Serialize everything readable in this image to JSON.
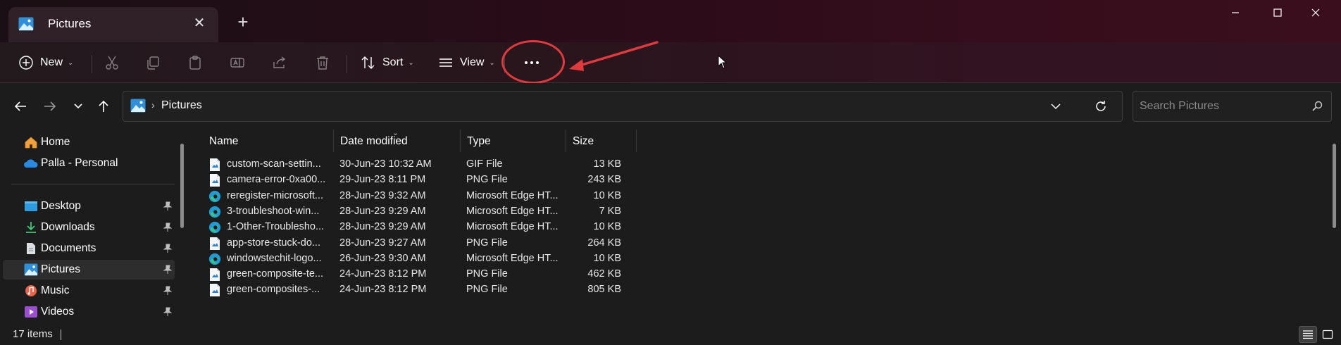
{
  "window": {
    "tab_title": "Pictures",
    "tab_close_glyph": "✕",
    "new_tab_glyph": "+",
    "minimize_glyph": "—",
    "maximize_glyph": "☐",
    "close_glyph": "✕"
  },
  "toolbar": {
    "new_label": "New",
    "sort_label": "Sort",
    "view_label": "View",
    "more_glyph": "···",
    "icons": [
      "add-icon",
      "cut-icon",
      "copy-icon",
      "paste-icon",
      "rename-icon",
      "share-icon",
      "delete-icon",
      "sort-icon",
      "view-icon",
      "more-options-icon"
    ]
  },
  "annotation": {
    "color": "#e03a3e"
  },
  "address_bar": {
    "separator": "›",
    "path": "Pictures",
    "search_placeholder": "Search Pictures"
  },
  "sidebar": {
    "items": [
      {
        "label": "Home",
        "icon": "home-icon",
        "pinned": false
      },
      {
        "label": "Palla - Personal",
        "icon": "onedrive-icon",
        "pinned": false
      },
      {
        "label": "Desktop",
        "icon": "desktop-icon",
        "pinned": true
      },
      {
        "label": "Downloads",
        "icon": "downloads-icon",
        "pinned": true
      },
      {
        "label": "Documents",
        "icon": "documents-icon",
        "pinned": true
      },
      {
        "label": "Pictures",
        "icon": "pictures-icon",
        "pinned": true,
        "selected": true
      },
      {
        "label": "Music",
        "icon": "music-icon",
        "pinned": true
      },
      {
        "label": "Videos",
        "icon": "videos-icon",
        "pinned": true
      }
    ]
  },
  "file_list": {
    "columns": [
      "Name",
      "Date modified",
      "Type",
      "Size"
    ],
    "sorted_by": "Date modified",
    "rows": [
      {
        "name": "custom-scan-settin...",
        "date": "30-Jun-23 10:32 AM",
        "type": "GIF File",
        "size": "13 KB",
        "icon": "image-file-icon"
      },
      {
        "name": "camera-error-0xa00...",
        "date": "29-Jun-23 8:11 PM",
        "type": "PNG File",
        "size": "243 KB",
        "icon": "image-file-icon"
      },
      {
        "name": "reregister-microsoft...",
        "date": "28-Jun-23 9:32 AM",
        "type": "Microsoft Edge HT...",
        "size": "10 KB",
        "icon": "edge-icon"
      },
      {
        "name": "3-troubleshoot-win...",
        "date": "28-Jun-23 9:29 AM",
        "type": "Microsoft Edge HT...",
        "size": "7 KB",
        "icon": "edge-icon"
      },
      {
        "name": "1-Other-Troublesho...",
        "date": "28-Jun-23 9:29 AM",
        "type": "Microsoft Edge HT...",
        "size": "10 KB",
        "icon": "edge-icon"
      },
      {
        "name": "app-store-stuck-do...",
        "date": "28-Jun-23 9:27 AM",
        "type": "PNG File",
        "size": "264 KB",
        "icon": "image-file-icon"
      },
      {
        "name": "windowstechit-logo...",
        "date": "26-Jun-23 9:30 AM",
        "type": "Microsoft Edge HT...",
        "size": "10 KB",
        "icon": "edge-icon"
      },
      {
        "name": "green-composite-te...",
        "date": "24-Jun-23 8:12 PM",
        "type": "PNG File",
        "size": "462 KB",
        "icon": "image-file-icon"
      },
      {
        "name": "green-composites-...",
        "date": "24-Jun-23 8:12 PM",
        "type": "PNG File",
        "size": "805 KB",
        "icon": "image-file-icon"
      }
    ]
  },
  "status_bar": {
    "item_count": "17 items"
  }
}
